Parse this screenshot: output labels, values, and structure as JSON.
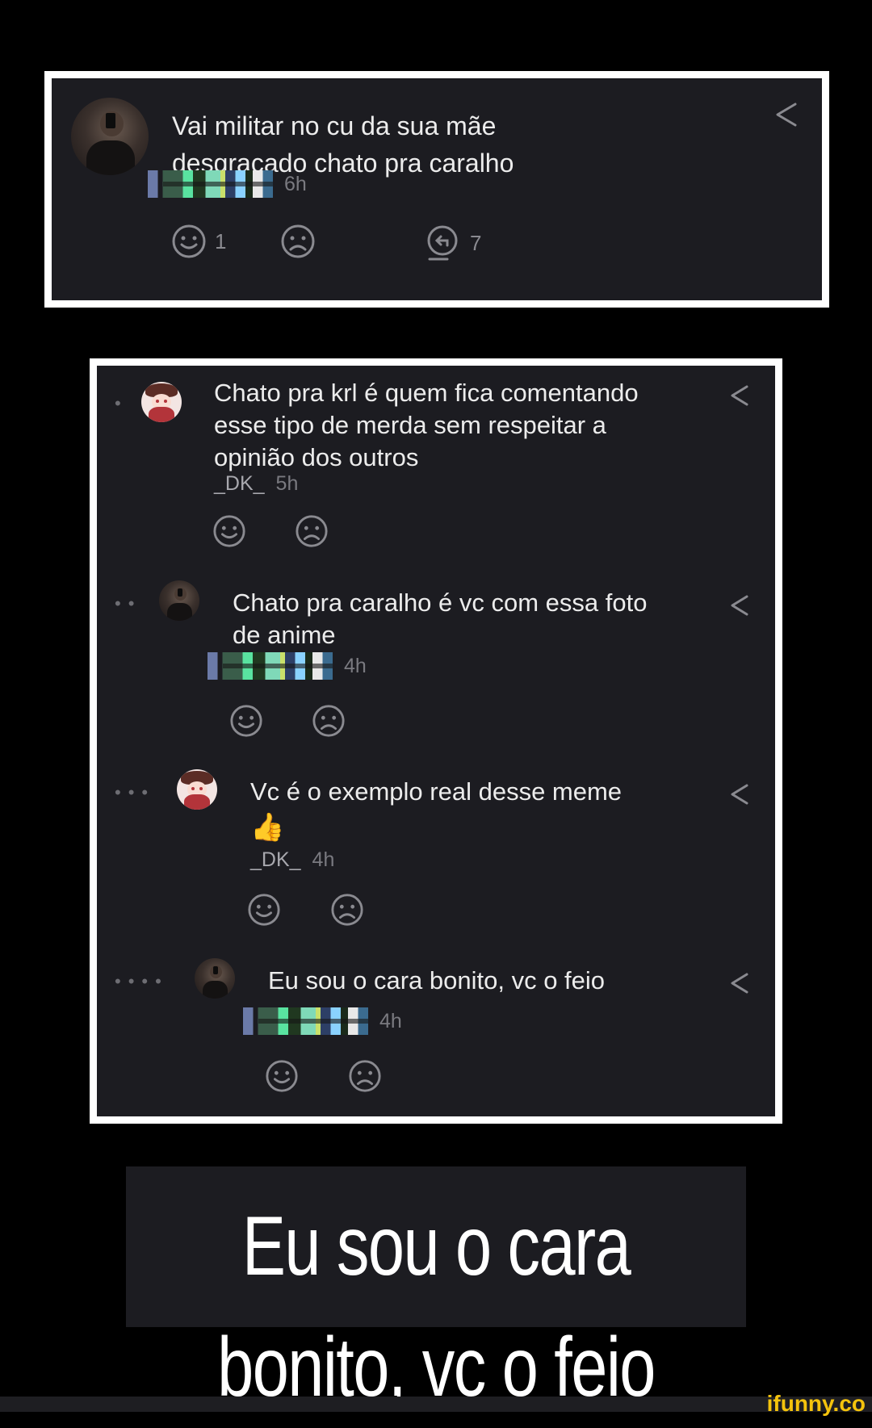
{
  "post": {
    "text": "Vai militar no cu da sua mãe\ndesgraçado chato pra caralho",
    "time": "6h",
    "likes": "1",
    "replies": "7"
  },
  "comments": [
    {
      "text": "Chato pra krl é quem fica comentando\nesse tipo de merda sem respeitar a\nopinião dos outros",
      "user": "_DK_",
      "time": "5h"
    },
    {
      "text": "Chato pra caralho é vc com essa foto\nde anime",
      "time": "4h"
    },
    {
      "text": "Vc é o exemplo real desse meme",
      "emoji": "👍",
      "user": "_DK_",
      "time": "4h"
    },
    {
      "text": "Eu sou o cara bonito, vc o feio",
      "time": "4h"
    }
  ],
  "caption": "Eu sou o cara bonito, vc o feio",
  "watermark": "ifunny.co",
  "icons": [
    "share-icon",
    "smile-icon",
    "frown-icon",
    "reply-icon"
  ]
}
